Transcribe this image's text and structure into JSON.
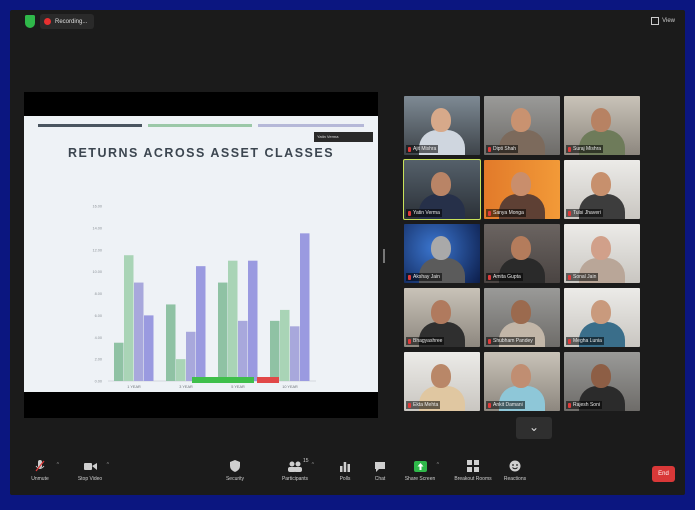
{
  "topbar": {
    "recording_label": "Recording...",
    "view_label": "View"
  },
  "slide": {
    "title": "RETURNS ACROSS ASSET CLASSES",
    "presenter_tag": "Yatin Verma"
  },
  "chart_data": {
    "type": "bar",
    "title": "RETURNS ACROSS ASSET CLASSES",
    "categories": [
      "1 YEAR",
      "3 YEAR",
      "5 YEAR",
      "10 YEAR"
    ],
    "series": [
      {
        "name": "",
        "values": [
          3.5,
          7.0,
          9.0,
          5.5
        ],
        "color": "#8fc2a4"
      },
      {
        "name": "",
        "values": [
          11.5,
          2.0,
          11.0,
          6.5
        ],
        "color": "#a9d4b6"
      },
      {
        "name": "",
        "values": [
          9.0,
          4.5,
          5.5,
          5.0
        ],
        "color": "#a8a8dc"
      },
      {
        "name": "",
        "values": [
          6.0,
          10.5,
          11.0,
          13.5
        ],
        "color": "#9a9ae0"
      }
    ],
    "ylim": [
      0,
      15
    ],
    "yticks": [
      "0.00",
      "2.00",
      "4.00",
      "6.00",
      "8.00",
      "10.00",
      "12.00",
      "14.00",
      "16.00"
    ],
    "highlight_labels": [
      "",
      ""
    ]
  },
  "participants": [
    {
      "name": "Ajit Mishra",
      "scene": "office",
      "skin": "#d7a98a",
      "shirt": "#cfd6df"
    },
    {
      "name": "Dipti Shah",
      "scene": "grey",
      "skin": "#c99270",
      "shirt": "#7c6a5c"
    },
    {
      "name": "Suraj Mishra",
      "scene": "room",
      "skin": "#b78263",
      "shirt": "#6e7b5a"
    },
    {
      "name": "Yatin Verma",
      "scene": "dark",
      "skin": "#b98466",
      "shirt": "#263049",
      "active": true
    },
    {
      "name": "Sanya Monga",
      "scene": "orange",
      "skin": "#c98e6c",
      "shirt": "#5e4034"
    },
    {
      "name": "Tulsi Jhaveri",
      "scene": "white",
      "skin": "#c7906d",
      "shirt": "#3d3d3d"
    },
    {
      "name": "Akshay Jain",
      "scene": "blue",
      "skin": "#a9a9a9",
      "shirt": "#5b5b5b"
    },
    {
      "name": "Amita Gupta",
      "scene": "cushion",
      "skin": "#b47c5c",
      "shirt": "#2a2a2a"
    },
    {
      "name": "Sonal Jain",
      "scene": "white",
      "skin": "#d1a08a",
      "shirt": "#b9a698"
    },
    {
      "name": "Bhagyashree",
      "scene": "room",
      "skin": "#b07a5e",
      "shirt": "#2f2f2f"
    },
    {
      "name": "Shubham Pandey",
      "scene": "grey",
      "skin": "#9b6a4e",
      "shirt": "#c2b6a8"
    },
    {
      "name": "Megha Lunia",
      "scene": "white",
      "skin": "#c99a7d",
      "shirt": "#3a6e8a"
    },
    {
      "name": "Ekta Mehta",
      "scene": "white",
      "skin": "#b98768",
      "shirt": "#e0c7a1"
    },
    {
      "name": "Ankit Damani",
      "scene": "room",
      "skin": "#c08e72",
      "shirt": "#8ec7d8"
    },
    {
      "name": "Rajesh Soni",
      "scene": "grey",
      "skin": "#8d5e45",
      "shirt": "#2b2b2b"
    }
  ],
  "toolbar": {
    "unmute": "Unmute",
    "stop_video": "Stop Video",
    "security": "Security",
    "participants": "Participants",
    "participants_count": "15",
    "polls": "Polls",
    "chat": "Chat",
    "share_screen": "Share Screen",
    "breakout": "Breakout Rooms",
    "reactions": "Reactions",
    "end": "End"
  },
  "colors": {
    "accent": "#2fb84a",
    "end": "#d93838",
    "active_speaker": "#c8e15a",
    "background": "#0b1680"
  }
}
